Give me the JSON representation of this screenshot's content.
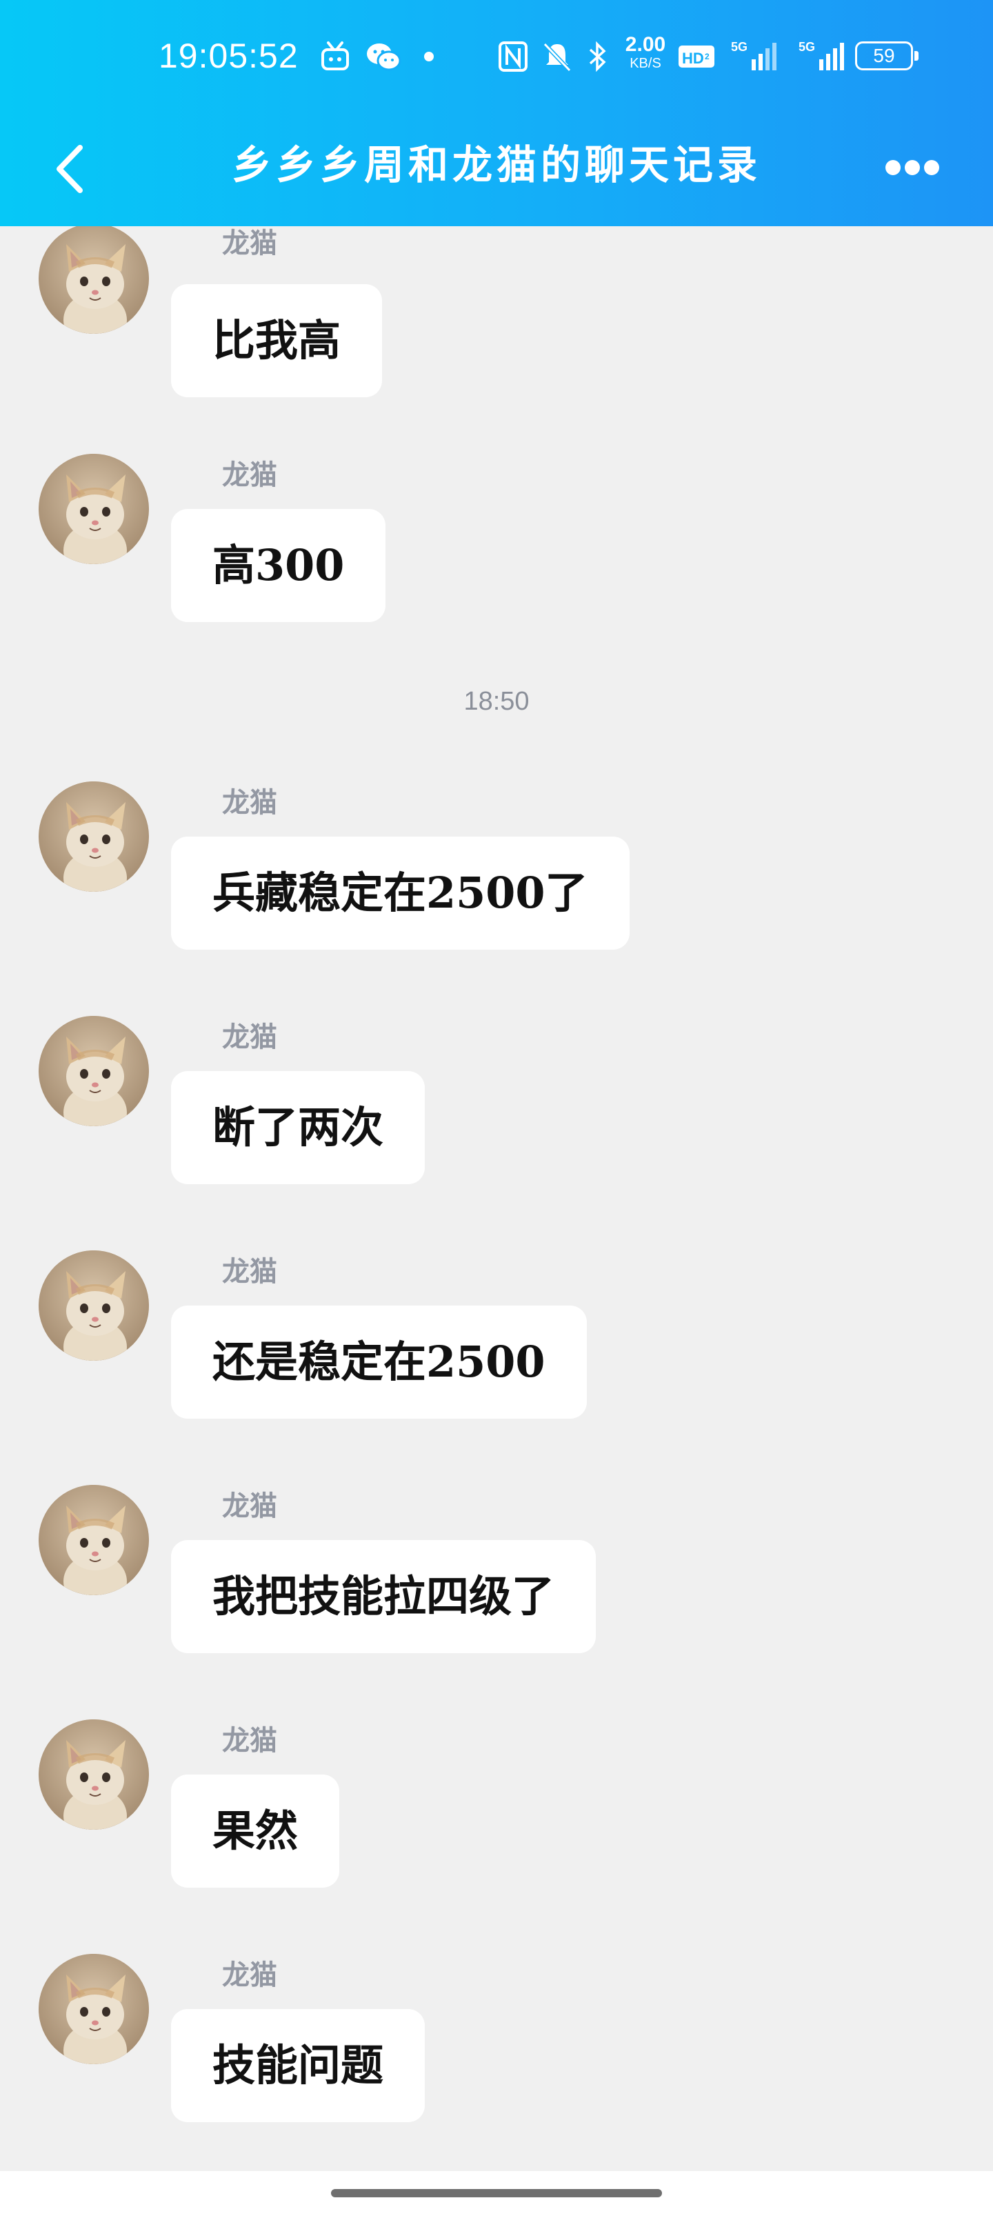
{
  "status_bar": {
    "time": "19:05:52",
    "net_speed": "2.00",
    "net_unit": "KB/S",
    "battery": "59",
    "icons": [
      "tv-icon",
      "wechat-icon",
      "dot-icon",
      "nfc-icon",
      "mute-icon",
      "bluetooth-icon",
      "hd-icon",
      "signal-5g-icon",
      "signal-5g-icon"
    ]
  },
  "header": {
    "title": "乡乡乡周和龙猫的聊天记录",
    "back_icon": "chevron-left-icon",
    "more_icon": "more-dots-icon"
  },
  "chat": {
    "messages": [
      {
        "sender": "龙猫",
        "text": "比我高"
      },
      {
        "sender": "龙猫",
        "text": "高300"
      },
      {
        "sender": "龙猫",
        "text": "兵藏稳定在2500了"
      },
      {
        "sender": "龙猫",
        "text": "断了两次"
      },
      {
        "sender": "龙猫",
        "text": "还是稳定在2500"
      },
      {
        "sender": "龙猫",
        "text": "我把技能拉四级了"
      },
      {
        "sender": "龙猫",
        "text": "果然"
      },
      {
        "sender": "龙猫",
        "text": "技能问题"
      }
    ],
    "timestamp": "18:50"
  },
  "colors": {
    "header_gradient_start": "#06c8f7",
    "header_gradient_end": "#1d94f6",
    "background": "#f0f0f0",
    "bubble": "#ffffff"
  }
}
